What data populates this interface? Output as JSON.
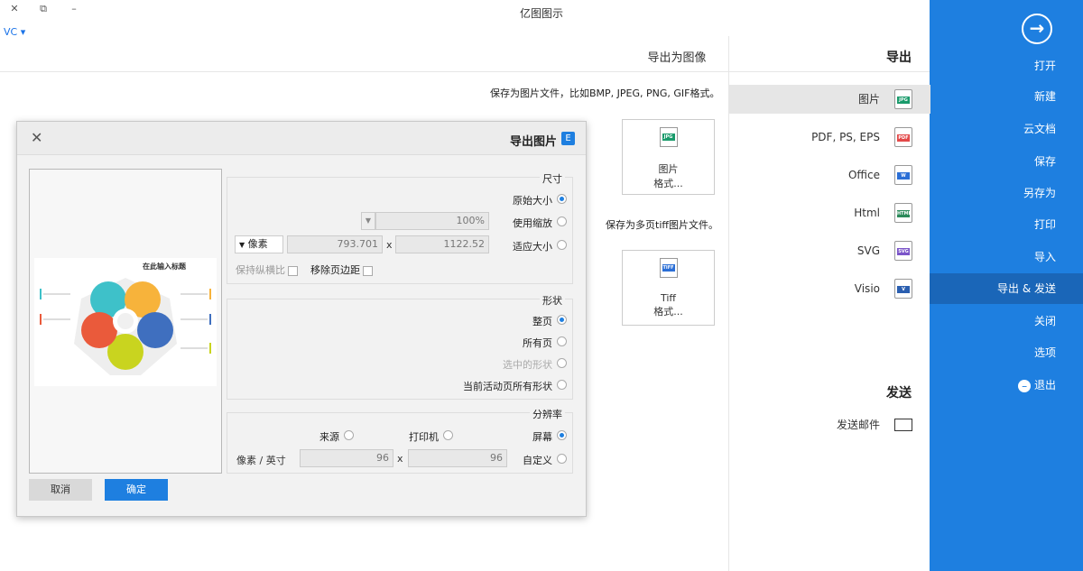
{
  "window": {
    "title": "亿图图示",
    "controls": [
      "✕",
      "⧉",
      "–"
    ],
    "user_menu": "VC ▾"
  },
  "sidebar": {
    "items": [
      {
        "label": "打开"
      },
      {
        "label": "新建"
      },
      {
        "label": "云文档"
      },
      {
        "label": "保存"
      },
      {
        "label": "另存为"
      },
      {
        "label": "打印"
      },
      {
        "label": "导入"
      },
      {
        "label": "导出 & 发送"
      },
      {
        "label": "关闭"
      },
      {
        "label": "选项"
      },
      {
        "label": "退出"
      }
    ],
    "active_index": 7
  },
  "export_pane": {
    "heading": "导出",
    "categories": [
      {
        "label": "图片",
        "icon": "JPG",
        "color": "#1a9b6c"
      },
      {
        "label": "PDF, PS, EPS",
        "icon": "PDF",
        "color": "#e34a4a"
      },
      {
        "label": "Office",
        "icon": "W",
        "color": "#2b6fd6"
      },
      {
        "label": "Html",
        "icon": "HTML",
        "color": "#2b8a5a"
      },
      {
        "label": "SVG",
        "icon": "SVG",
        "color": "#7b55c9"
      },
      {
        "label": "Visio",
        "icon": "V",
        "color": "#2b5fb0"
      }
    ],
    "send_heading": "发送",
    "send_mail": "发送邮件"
  },
  "main": {
    "title": "导出为图像",
    "desc_image": "保存为图片文件，比如BMP, JPEG, PNG, GIF格式。",
    "card_image": {
      "line1": "图片",
      "line2": "格式...",
      "icon": "JPG"
    },
    "desc_tiff": "保存为多页tiff图片文件。",
    "card_tiff": {
      "line1": "Tiff",
      "line2": "格式...",
      "icon": "TIFF"
    }
  },
  "dialog": {
    "title": "导出图片",
    "size": {
      "legend": "尺寸",
      "original": "原始大小",
      "zoom": "使用缩放",
      "zoom_value": "100%",
      "fit": "适应大小",
      "width": "1122.52",
      "height": "793.701",
      "unit": "像素",
      "x": "x",
      "remove_margin": "移除页边距",
      "keep_ratio": "保持纵横比"
    },
    "shape": {
      "legend": "形状",
      "whole_page": "整页",
      "all_pages": "所有页",
      "selected": "选中的形状",
      "current_page_all": "当前活动页所有形状"
    },
    "resolution": {
      "legend": "分辨率",
      "screen": "屏幕",
      "printer": "打印机",
      "source": "来源",
      "custom": "自定义",
      "dpi_x": "96",
      "dpi_y": "96",
      "x": "x",
      "unit": "像素 / 英寸"
    },
    "ok": "确定",
    "cancel": "取消",
    "preview_title": "在此输入标题"
  }
}
